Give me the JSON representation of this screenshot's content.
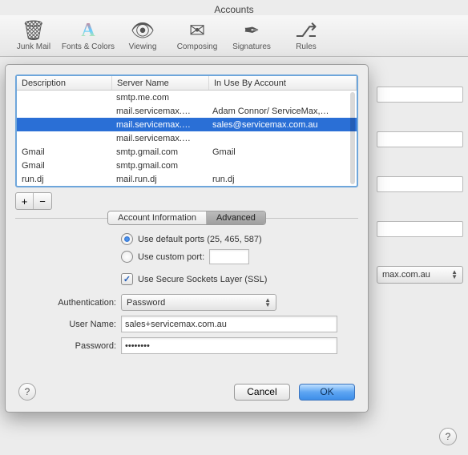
{
  "window_title": "Accounts",
  "toolbar": [
    {
      "label": "Junk Mail",
      "icon": "🗑"
    },
    {
      "label": "Fonts & Colors",
      "icon": "A"
    },
    {
      "label": "Viewing",
      "icon": "👁"
    },
    {
      "label": "Composing",
      "icon": "✉"
    },
    {
      "label": "Signatures",
      "icon": "✒"
    },
    {
      "label": "Rules",
      "icon": "⎇"
    }
  ],
  "background": {
    "combo_value": "max.com.au"
  },
  "sheet": {
    "columns": [
      "Description",
      "Server Name",
      "In Use By Account"
    ],
    "rows": [
      {
        "desc": "",
        "server": "smtp.me.com",
        "inuse": ""
      },
      {
        "desc": "",
        "server": "mail.servicemax.…",
        "inuse": "Adam Connor/ ServiceMax,…"
      },
      {
        "desc": "",
        "server": "mail.servicemax.…",
        "inuse": "sales@servicemax.com.au",
        "selected": true
      },
      {
        "desc": "",
        "server": "mail.servicemax.…",
        "inuse": ""
      },
      {
        "desc": "Gmail",
        "server": "smtp.gmail.com",
        "inuse": "Gmail"
      },
      {
        "desc": "Gmail",
        "server": "smtp.gmail.com",
        "inuse": ""
      },
      {
        "desc": "run.dj",
        "server": "mail.run.dj",
        "inuse": "run.dj"
      }
    ],
    "add_label": "+",
    "remove_label": "−",
    "tabs": {
      "info": "Account Information",
      "advanced": "Advanced"
    },
    "ports": {
      "default_label": "Use default ports (25, 465, 587)",
      "custom_label": "Use custom port:",
      "custom_value": ""
    },
    "ssl_label": "Use Secure Sockets Layer (SSL)",
    "auth_label": "Authentication:",
    "auth_value": "Password",
    "user_label": "User Name:",
    "user_value": "sales+servicemax.com.au",
    "pass_label": "Password:",
    "pass_value": "••••••••",
    "cancel": "Cancel",
    "ok": "OK"
  }
}
